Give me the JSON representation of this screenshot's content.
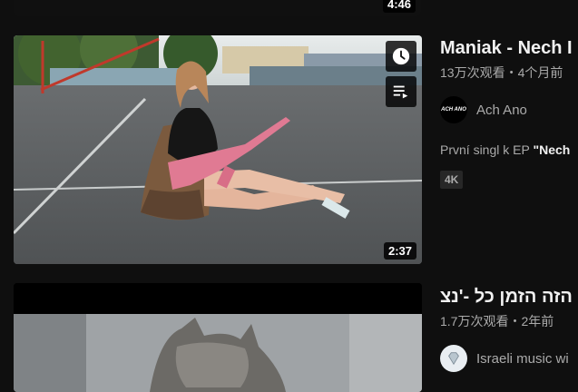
{
  "videos": [
    {
      "duration": "4:46"
    },
    {
      "title": "Maniak - Nech I",
      "meta": "13万次观看・4个月前",
      "channel": "Ach Ano",
      "avatar_text": "ACH ANO",
      "description_prefix": "První singl k EP ",
      "description_bold": "\"Nech",
      "badge": "4K",
      "duration": "2:37",
      "overlay_buttons": [
        "clock-icon",
        "add-to-queue-icon"
      ]
    },
    {
      "title": "הזה הזמן כל -'נצ",
      "meta": "1.7万次观看・2年前",
      "channel": "Israeli music wi"
    }
  ]
}
